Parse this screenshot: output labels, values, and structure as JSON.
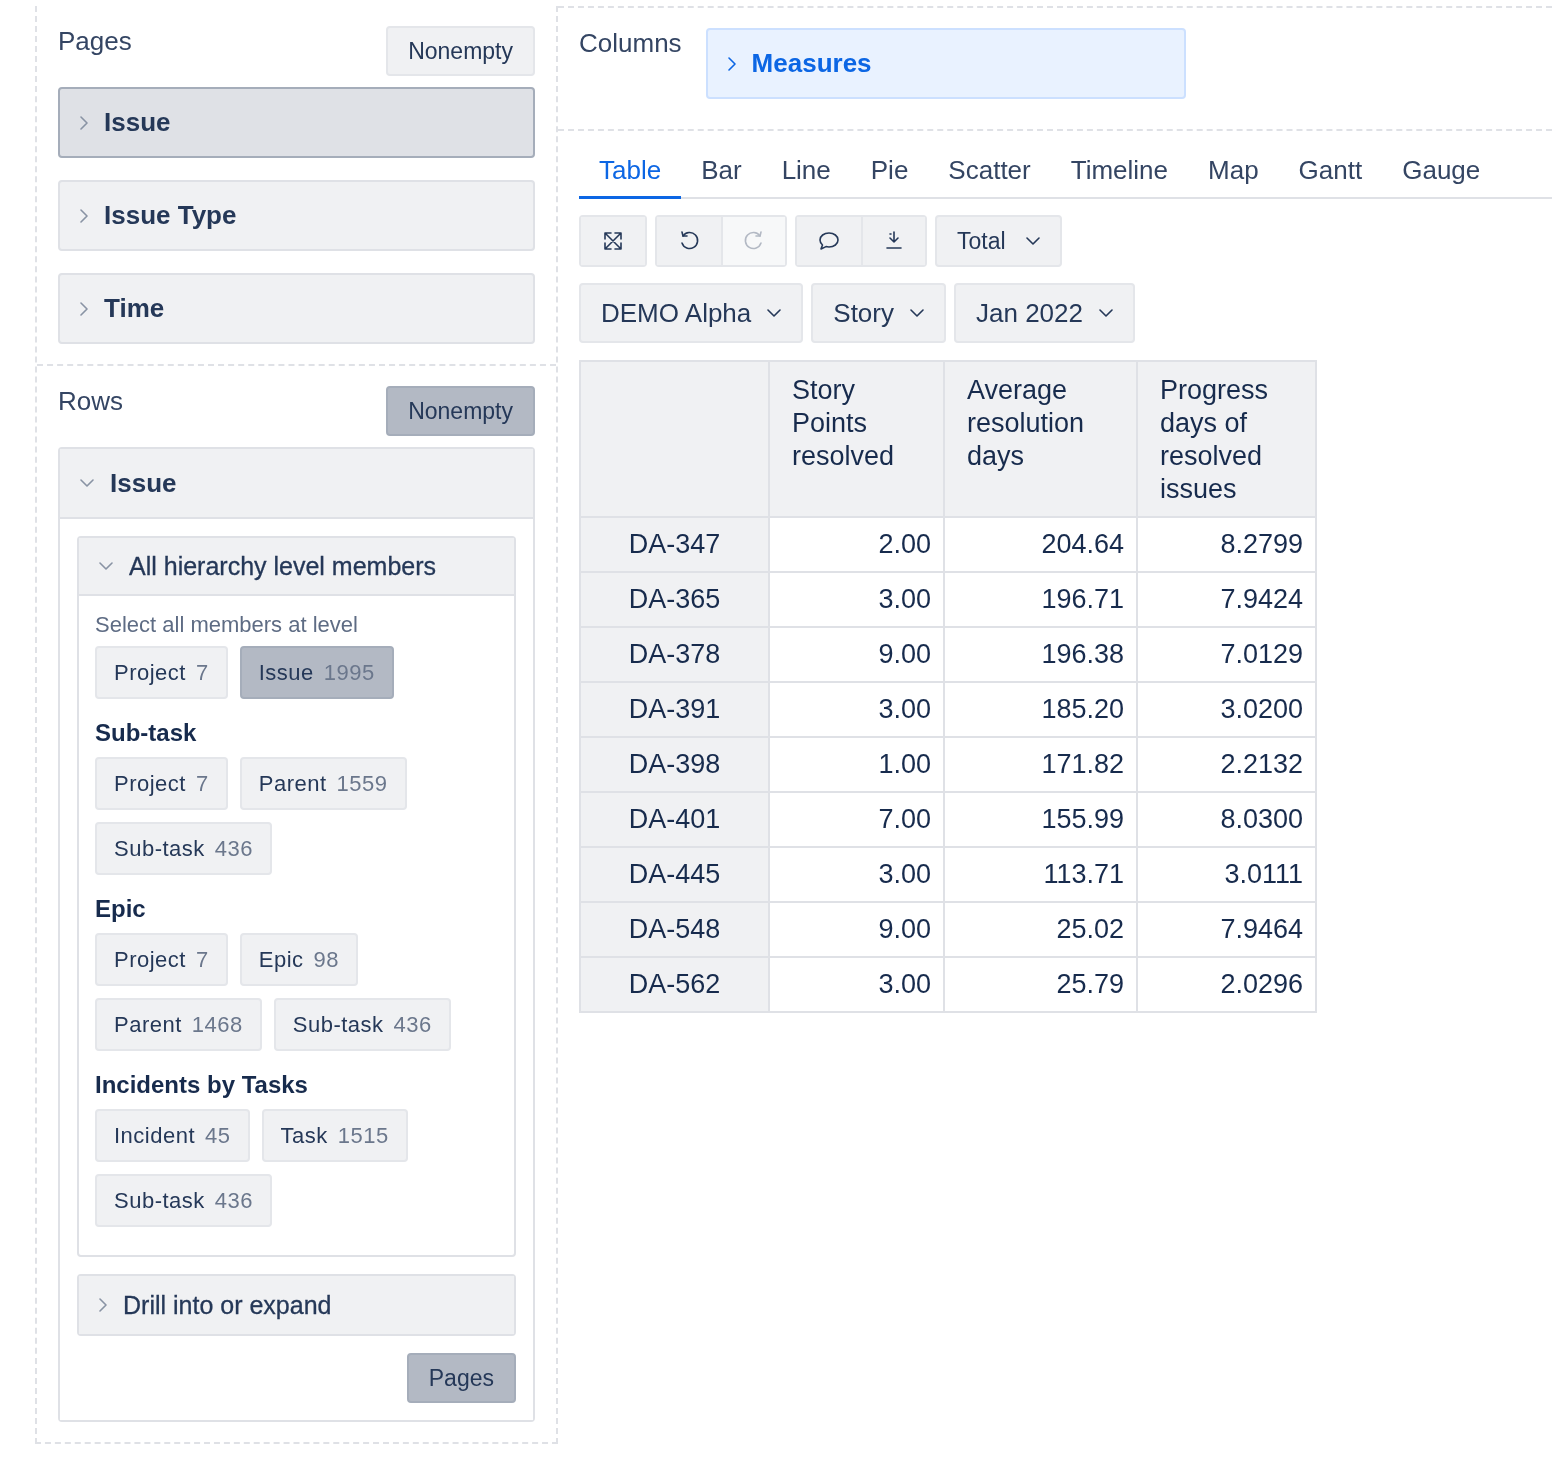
{
  "pages": {
    "title": "Pages",
    "nonempty": {
      "label": "Nonempty",
      "selected": false
    },
    "items": [
      {
        "label": "Issue",
        "selected": true,
        "expanded": false
      },
      {
        "label": "Issue Type",
        "selected": false,
        "expanded": false
      },
      {
        "label": "Time",
        "selected": false,
        "expanded": false
      }
    ]
  },
  "rows": {
    "title": "Rows",
    "nonempty": {
      "label": "Nonempty",
      "selected": true
    },
    "items": [
      {
        "label": "Issue",
        "expanded": true,
        "sections": [
          {
            "title": "All hierarchy level members",
            "expanded": true,
            "groups": [
              {
                "kind": "caption",
                "title": "Select all members at level",
                "chips": [
                  {
                    "label": "Project",
                    "count": "7",
                    "selected": false
                  },
                  {
                    "label": "Issue",
                    "count": "1995",
                    "selected": true
                  }
                ]
              },
              {
                "kind": "heading",
                "title": "Sub-task",
                "chips": [
                  {
                    "label": "Project",
                    "count": "7",
                    "selected": false
                  },
                  {
                    "label": "Parent",
                    "count": "1559",
                    "selected": false
                  },
                  {
                    "label": "Sub-task",
                    "count": "436",
                    "selected": false
                  }
                ]
              },
              {
                "kind": "heading",
                "title": "Epic",
                "chips": [
                  {
                    "label": "Project",
                    "count": "7",
                    "selected": false
                  },
                  {
                    "label": "Epic",
                    "count": "98",
                    "selected": false
                  },
                  {
                    "label": "Parent",
                    "count": "1468",
                    "selected": false
                  },
                  {
                    "label": "Sub-task",
                    "count": "436",
                    "selected": false
                  }
                ]
              },
              {
                "kind": "heading",
                "title": "Incidents by Tasks",
                "chips": [
                  {
                    "label": "Incident",
                    "count": "45",
                    "selected": false
                  },
                  {
                    "label": "Task",
                    "count": "1515",
                    "selected": false
                  },
                  {
                    "label": "Sub-task",
                    "count": "436",
                    "selected": false
                  }
                ]
              }
            ]
          },
          {
            "title": "Drill into or expand",
            "expanded": false
          }
        ],
        "action": "Pages"
      }
    ]
  },
  "columns": {
    "title": "Columns",
    "items": [
      {
        "label": "Measures",
        "expanded": false
      }
    ]
  },
  "tabs": [
    {
      "label": "Table",
      "selected": true
    },
    {
      "label": "Bar",
      "selected": false
    },
    {
      "label": "Line",
      "selected": false
    },
    {
      "label": "Pie",
      "selected": false
    },
    {
      "label": "Scatter",
      "selected": false
    },
    {
      "label": "Timeline",
      "selected": false
    },
    {
      "label": "Map",
      "selected": false
    },
    {
      "label": "Gantt",
      "selected": false
    },
    {
      "label": "Gauge",
      "selected": false
    }
  ],
  "toolbar": [
    {
      "buttons": [
        {
          "kind": "fullscreen",
          "disabled": false
        }
      ]
    },
    {
      "buttons": [
        {
          "kind": "undo",
          "disabled": false
        },
        {
          "kind": "redo",
          "disabled": true
        }
      ]
    },
    {
      "buttons": [
        {
          "kind": "comment",
          "disabled": false
        },
        {
          "kind": "download",
          "disabled": false
        }
      ]
    },
    {
      "dropdown": "Total"
    }
  ],
  "filters": [
    {
      "label": "DEMO Alpha"
    },
    {
      "label": "Story"
    },
    {
      "label": "Jan 2022"
    }
  ],
  "table": {
    "columns": [
      "Story Points resolved",
      "Average resolution days",
      "Progress days of resolved issues"
    ],
    "rows": [
      {
        "header": "DA-347",
        "cells": [
          "2.00",
          "204.64",
          "8.2799"
        ]
      },
      {
        "header": "DA-365",
        "cells": [
          "3.00",
          "196.71",
          "7.9424"
        ]
      },
      {
        "header": "DA-378",
        "cells": [
          "9.00",
          "196.38",
          "7.0129"
        ]
      },
      {
        "header": "DA-391",
        "cells": [
          "3.00",
          "185.20",
          "3.0200"
        ]
      },
      {
        "header": "DA-398",
        "cells": [
          "1.00",
          "171.82",
          "2.2132"
        ]
      },
      {
        "header": "DA-401",
        "cells": [
          "7.00",
          "155.99",
          "8.0300"
        ]
      },
      {
        "header": "DA-445",
        "cells": [
          "3.00",
          "113.71",
          "3.0111"
        ]
      },
      {
        "header": "DA-548",
        "cells": [
          "9.00",
          "25.02",
          "7.9464"
        ]
      },
      {
        "header": "DA-562",
        "cells": [
          "3.00",
          "25.79",
          "2.0296"
        ]
      }
    ]
  }
}
